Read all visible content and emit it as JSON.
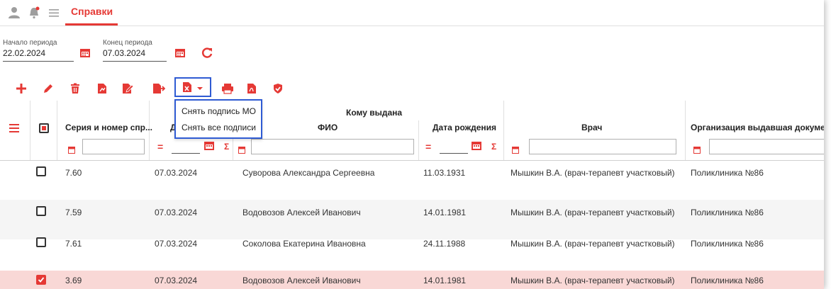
{
  "colors": {
    "accent": "#e53935",
    "selection_border": "#2f5bd3",
    "selected_row": "#f9d8d6"
  },
  "header": {
    "tab_title": "Справки"
  },
  "period": {
    "start_label": "Начало периода",
    "start_value": "22.02.2024",
    "end_label": "Конец периода",
    "end_value": "07.03.2024"
  },
  "dropdown": {
    "items": [
      "Снять подпись МО",
      "Снять все подписи"
    ]
  },
  "table": {
    "group_header": "Кому выдана",
    "columns": {
      "series": "Серия и номер спр...",
      "date_issued_partial": "Д",
      "fio": "ФИО",
      "birth_date": "Дата рождения",
      "doctor": "Врач",
      "org": "Организация выдавшая документ"
    },
    "rows": [
      {
        "checked": false,
        "series": "7.60",
        "date": "07.03.2024",
        "fio": "Суворова Александра Сергеевна",
        "birth": "11.03.1931",
        "doctor": "Мышкин В.А. (врач-терапевт участковый)",
        "org": "Поликлиника №86"
      },
      {
        "checked": false,
        "series": "7.59",
        "date": "07.03.2024",
        "fio": "Водовозов Алексей Иванович",
        "birth": "14.01.1981",
        "doctor": "Мышкин В.А. (врач-терапевт участковый)",
        "org": "Поликлиника №86"
      },
      {
        "checked": false,
        "series": "7.61",
        "date": "07.03.2024",
        "fio": "Соколова Екатерина Ивановна",
        "birth": "24.11.1988",
        "doctor": "Мышкин В.А. (врач-терапевт участковый)",
        "org": "Поликлиника №86"
      },
      {
        "checked": true,
        "series": "3.69",
        "date": "07.03.2024",
        "fio": "Водовозов Алексей Иванович",
        "birth": "14.01.1981",
        "doctor": "Мышкин В.А. (врач-терапевт участковый)",
        "org": "Поликлиника №86"
      }
    ]
  }
}
